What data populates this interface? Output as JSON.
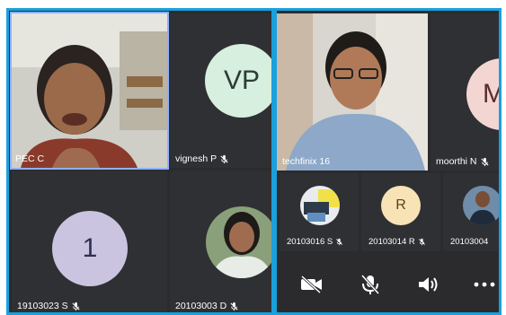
{
  "left_grid": {
    "tiles": [
      {
        "name": "PEC C",
        "muted": false,
        "kind": "video"
      },
      {
        "name": "vignesh P",
        "muted": true,
        "kind": "initials",
        "initials": "VP",
        "avatar_color": "#d6efde",
        "initials_color": "#2e3b33"
      },
      {
        "name": "19103023 S",
        "muted": true,
        "kind": "initials",
        "initials": "1",
        "avatar_color": "#cbc4e0",
        "initials_color": "#2d2f52"
      },
      {
        "name": "20103003 D",
        "muted": true,
        "kind": "photo"
      }
    ]
  },
  "right_grid": {
    "tiles": [
      {
        "name": "techfinix 16",
        "muted": false,
        "kind": "video"
      },
      {
        "name": "moorthi N",
        "muted": true,
        "kind": "initials",
        "initials": "M",
        "avatar_color": "#f3d6d2",
        "initials_color": "#5a2d2d"
      }
    ],
    "thumbnails": [
      {
        "name": "20103016 S",
        "muted": true,
        "kind": "photo"
      },
      {
        "name": "20103014 R",
        "muted": true,
        "kind": "initials",
        "initials": "R",
        "avatar_color": "#f8e3b6",
        "initials_color": "#5a4416"
      },
      {
        "name": "20103004",
        "muted": false,
        "kind": "photo"
      }
    ],
    "controls": [
      {
        "icon": "video-off-icon"
      },
      {
        "icon": "mic-off-icon"
      },
      {
        "icon": "speaker-icon"
      },
      {
        "icon": "more-options-icon"
      }
    ]
  },
  "colors": {
    "accent_border": "#1aa0dc",
    "panel_bg": "#2b2b2d",
    "tile_bg": "#2f3033"
  }
}
